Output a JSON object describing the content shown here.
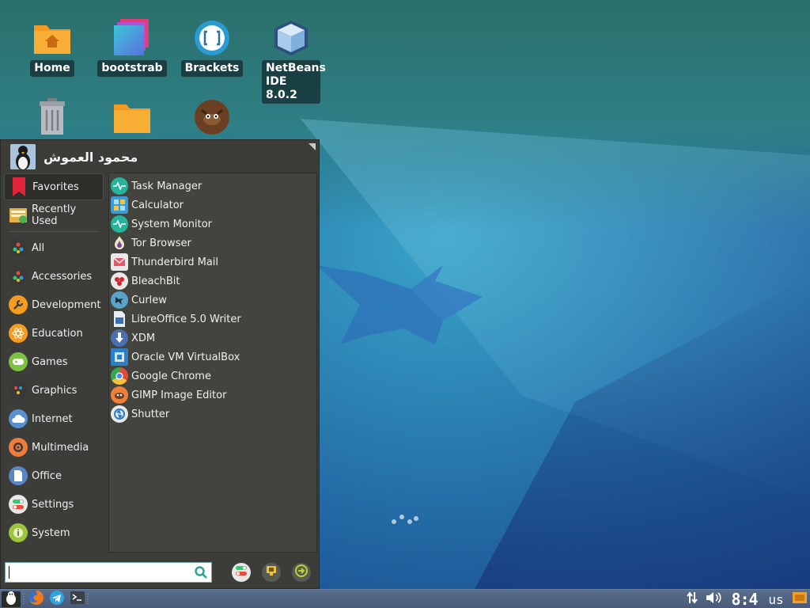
{
  "desktop": {
    "icons": [
      {
        "label": "Home"
      },
      {
        "label": "bootstrab"
      },
      {
        "label": "Brackets"
      },
      {
        "label": "NetBeans IDE 8.0.2"
      },
      {
        "label": "Trash"
      },
      {
        "label": "Folder"
      },
      {
        "label": "GIMP"
      }
    ]
  },
  "menu": {
    "user_name": "محمود العموش",
    "categories": [
      {
        "label": "Favorites",
        "icon": "bookmark-icon",
        "color": "#e0243a"
      },
      {
        "label": "Recently Used",
        "icon": "recent-icon",
        "color": "#e8b04a"
      },
      {
        "label": "All",
        "icon": "apps-icon",
        "color": "#39393a"
      },
      {
        "label": "Accessories",
        "icon": "accessories-icon",
        "color": "#39393a"
      },
      {
        "label": "Development",
        "icon": "wrench-icon",
        "color": "#f39c1f"
      },
      {
        "label": "Education",
        "icon": "atom-icon",
        "color": "#f39c1f"
      },
      {
        "label": "Games",
        "icon": "gamepad-icon",
        "color": "#7cc242"
      },
      {
        "label": "Graphics",
        "icon": "graphics-icon",
        "color": "#39393a"
      },
      {
        "label": "Internet",
        "icon": "cloud-icon",
        "color": "#5a8fd0"
      },
      {
        "label": "Multimedia",
        "icon": "speaker-icon",
        "color": "#f07b3c"
      },
      {
        "label": "Office",
        "icon": "document-icon",
        "color": "#5b86c4"
      },
      {
        "label": "Settings",
        "icon": "toggle-icon",
        "color": "#e8e8e8"
      },
      {
        "label": "System",
        "icon": "info-icon",
        "color": "#9bc53d"
      }
    ],
    "apps": [
      {
        "label": "Task Manager",
        "icon": "pulse-icon",
        "color": "#26b39b"
      },
      {
        "label": "Calculator",
        "icon": "calculator-icon",
        "color": "#3a9bd9"
      },
      {
        "label": "System Monitor",
        "icon": "pulse-icon",
        "color": "#26b39b"
      },
      {
        "label": "Tor Browser",
        "icon": "onion-icon",
        "color": "#7d4698"
      },
      {
        "label": "Thunderbird Mail",
        "icon": "mail-icon",
        "color": "#e8e8e8"
      },
      {
        "label": "BleachBit",
        "icon": "bleachbit-icon",
        "color": "#e8e8e8"
      },
      {
        "label": "Curlew",
        "icon": "bird-icon",
        "color": "#57a3c9"
      },
      {
        "label": "LibreOffice 5.0 Writer",
        "icon": "writer-icon",
        "color": "#3a6fb5"
      },
      {
        "label": "XDM",
        "icon": "download-icon",
        "color": "#4a6fb0"
      },
      {
        "label": "Oracle VM VirtualBox",
        "icon": "virtualbox-icon",
        "color": "#2c7fc6"
      },
      {
        "label": "Google Chrome",
        "icon": "chrome-icon",
        "color": "#e24a3b"
      },
      {
        "label": "GIMP Image Editor",
        "icon": "gimp-icon",
        "color": "#f0803c"
      },
      {
        "label": "Shutter",
        "icon": "shutter-icon",
        "color": "#e8e8e8"
      }
    ],
    "search": {
      "value": "",
      "placeholder": ""
    },
    "actions": [
      {
        "icon": "settings-toggle-icon"
      },
      {
        "icon": "lock-screen-icon"
      },
      {
        "icon": "logout-icon"
      }
    ]
  },
  "taskbar": {
    "clock": "8:4",
    "keyboard_layout": "us"
  }
}
